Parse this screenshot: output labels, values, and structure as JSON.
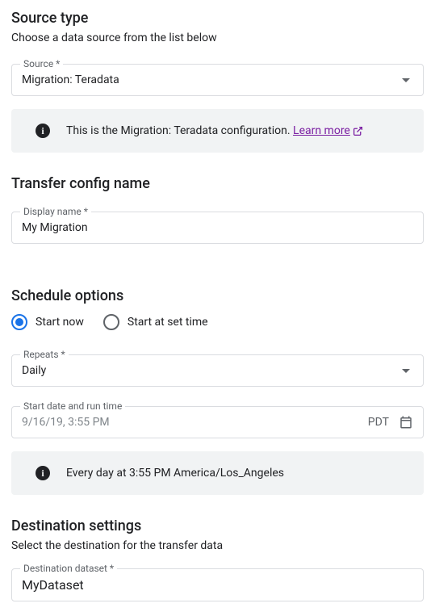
{
  "source_type": {
    "heading": "Source type",
    "description": "Choose a data source from the list below",
    "field_label": "Source *",
    "field_value": "Migration: Teradata",
    "info_text": "This is the Migration: Teradata configuration. ",
    "learn_more_label": "Learn more"
  },
  "transfer_config": {
    "heading": "Transfer config name",
    "field_label": "Display name *",
    "field_value": "My Migration"
  },
  "schedule": {
    "heading": "Schedule options",
    "radio_start_now": "Start now",
    "radio_start_set": "Start at set time",
    "selected": "start_now",
    "repeats_label": "Repeats *",
    "repeats_value": "Daily",
    "start_label": "Start date and run time",
    "start_placeholder": "9/16/19, 3:55 PM",
    "tz": "PDT",
    "info_text": "Every day at 3:55 PM America/Los_Angeles"
  },
  "destination": {
    "heading": "Destination settings",
    "description": "Select the destination for the transfer data",
    "field_label": "Destination dataset *",
    "field_value": "MyDataset"
  }
}
